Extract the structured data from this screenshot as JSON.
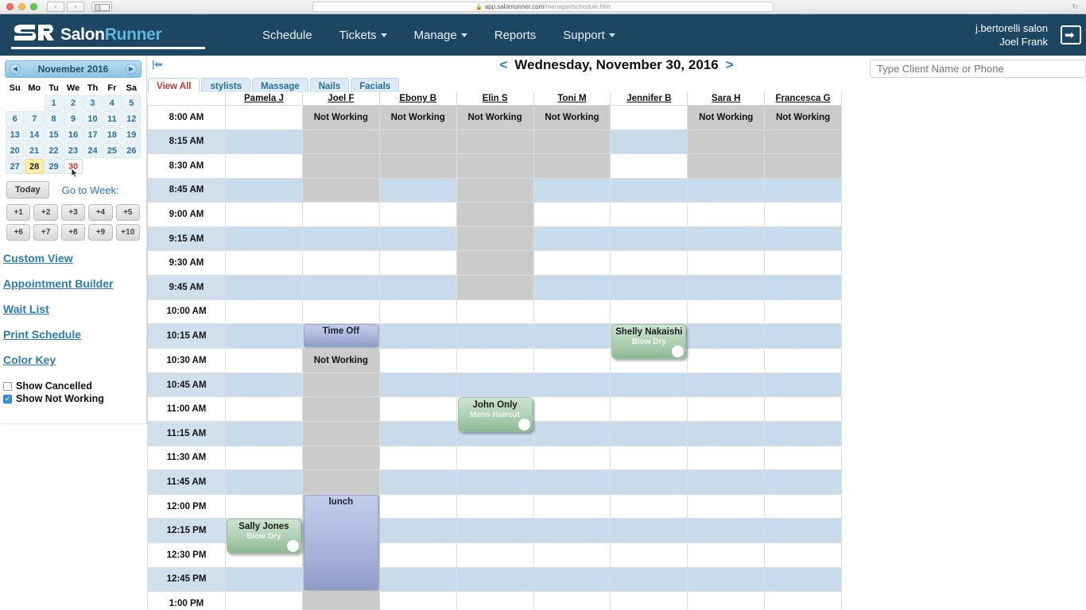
{
  "browser": {
    "url_lock": "🔒",
    "url_host": "app.salonrunner.com",
    "url_path": "/manager/schedule.htm",
    "reload_icon": "↻",
    "back_icon": "‹",
    "forward_icon": "›"
  },
  "header": {
    "logo_salon": "Salon",
    "logo_runner": "Runner",
    "nav": [
      {
        "label": "Schedule",
        "caret": false
      },
      {
        "label": "Tickets",
        "caret": true
      },
      {
        "label": "Manage",
        "caret": true
      },
      {
        "label": "Reports",
        "caret": false
      },
      {
        "label": "Support",
        "caret": true
      }
    ],
    "account_salon": "j.bertorelli salon",
    "account_user": "Joel Frank",
    "logout_icon": "➡"
  },
  "sidebar": {
    "calendar": {
      "month_label": "November 2016",
      "prev_icon": "◀",
      "next_icon": "▶",
      "weekdays": [
        "Su",
        "Mo",
        "Tu",
        "We",
        "Th",
        "Fr",
        "Sa"
      ],
      "weeks": [
        [
          "",
          "",
          "1",
          "2",
          "3",
          "4",
          "5"
        ],
        [
          "6",
          "7",
          "8",
          "9",
          "10",
          "11",
          "12"
        ],
        [
          "13",
          "14",
          "15",
          "16",
          "17",
          "18",
          "19"
        ],
        [
          "20",
          "21",
          "22",
          "23",
          "24",
          "25",
          "26"
        ],
        [
          "27",
          "28",
          "29",
          "30",
          "",
          "",
          ""
        ]
      ],
      "today": "28",
      "selected": "30"
    },
    "today_button": "Today",
    "goto_week_label": "Go to Week:",
    "week_buttons": [
      "+1",
      "+2",
      "+3",
      "+4",
      "+5",
      "+6",
      "+7",
      "+8",
      "+9",
      "+10"
    ],
    "links": [
      "Custom View",
      "Appointment Builder",
      "Wait List",
      "Print Schedule",
      "Color Key"
    ],
    "checkboxes": [
      {
        "label": "Show Cancelled",
        "checked": false
      },
      {
        "label": "Show Not Working",
        "checked": true
      }
    ],
    "check_mark": "✓"
  },
  "main": {
    "collapse_icon": "|⬅",
    "date_prev": "<",
    "date_next": ">",
    "date_title": "Wednesday, November 30, 2016",
    "search_placeholder": "Type Client Name or Phone",
    "search_value": "",
    "tabs": [
      {
        "label": "View All",
        "active": true
      },
      {
        "label": "stylists",
        "active": false
      },
      {
        "label": "Massage",
        "active": false
      },
      {
        "label": "Nails",
        "active": false
      },
      {
        "label": "Facials",
        "active": false
      }
    ],
    "time_column_header": "",
    "stylists": [
      "Pamela J",
      "Joel F",
      "Ebony B",
      "Elin S",
      "Toni M",
      "Jennifer B",
      "Sara H",
      "Francesca G"
    ],
    "times": [
      "8:00 AM",
      "8:15 AM",
      "8:30 AM",
      "8:45 AM",
      "9:00 AM",
      "9:15 AM",
      "9:30 AM",
      "9:45 AM",
      "10:00 AM",
      "10:15 AM",
      "10:30 AM",
      "10:45 AM",
      "11:00 AM",
      "11:15 AM",
      "11:30 AM",
      "11:45 AM",
      "12:00 PM",
      "12:15 PM",
      "12:30 PM",
      "12:45 PM",
      "1:00 PM"
    ],
    "not_working_label": "Not Working",
    "not_working_blocks": [
      {
        "stylist": 1,
        "start": 0,
        "end": 4,
        "label": "Not Working"
      },
      {
        "stylist": 1,
        "start": 10,
        "end": 21,
        "label": "Not Working"
      },
      {
        "stylist": 2,
        "start": 0,
        "end": 3,
        "label": "Not Working"
      },
      {
        "stylist": 3,
        "start": 0,
        "end": 8,
        "label": "Not Working"
      },
      {
        "stylist": 4,
        "start": 0,
        "end": 3,
        "label": "Not Working"
      },
      {
        "stylist": 6,
        "start": 0,
        "end": 3,
        "label": "Not Working"
      },
      {
        "stylist": 7,
        "start": 0,
        "end": 3,
        "label": "Not Working"
      }
    ],
    "appointments": [
      {
        "stylist": 1,
        "start": 9,
        "span": 1,
        "client": "Time Off",
        "service": "",
        "type": "block"
      },
      {
        "stylist": 5,
        "start": 9,
        "span": 1.5,
        "client": "Shelly Nakaishi",
        "service": "Blow Dry",
        "type": "green"
      },
      {
        "stylist": 3,
        "start": 12,
        "span": 1.5,
        "client": "John Only",
        "service": "Mens Haircut",
        "type": "green"
      },
      {
        "stylist": 1,
        "start": 16,
        "span": 4,
        "client": "lunch",
        "service": "",
        "type": "block"
      },
      {
        "stylist": 0,
        "start": 17,
        "span": 1.5,
        "client": "Sally Jones",
        "service": "Blow Dry",
        "type": "green"
      }
    ]
  }
}
